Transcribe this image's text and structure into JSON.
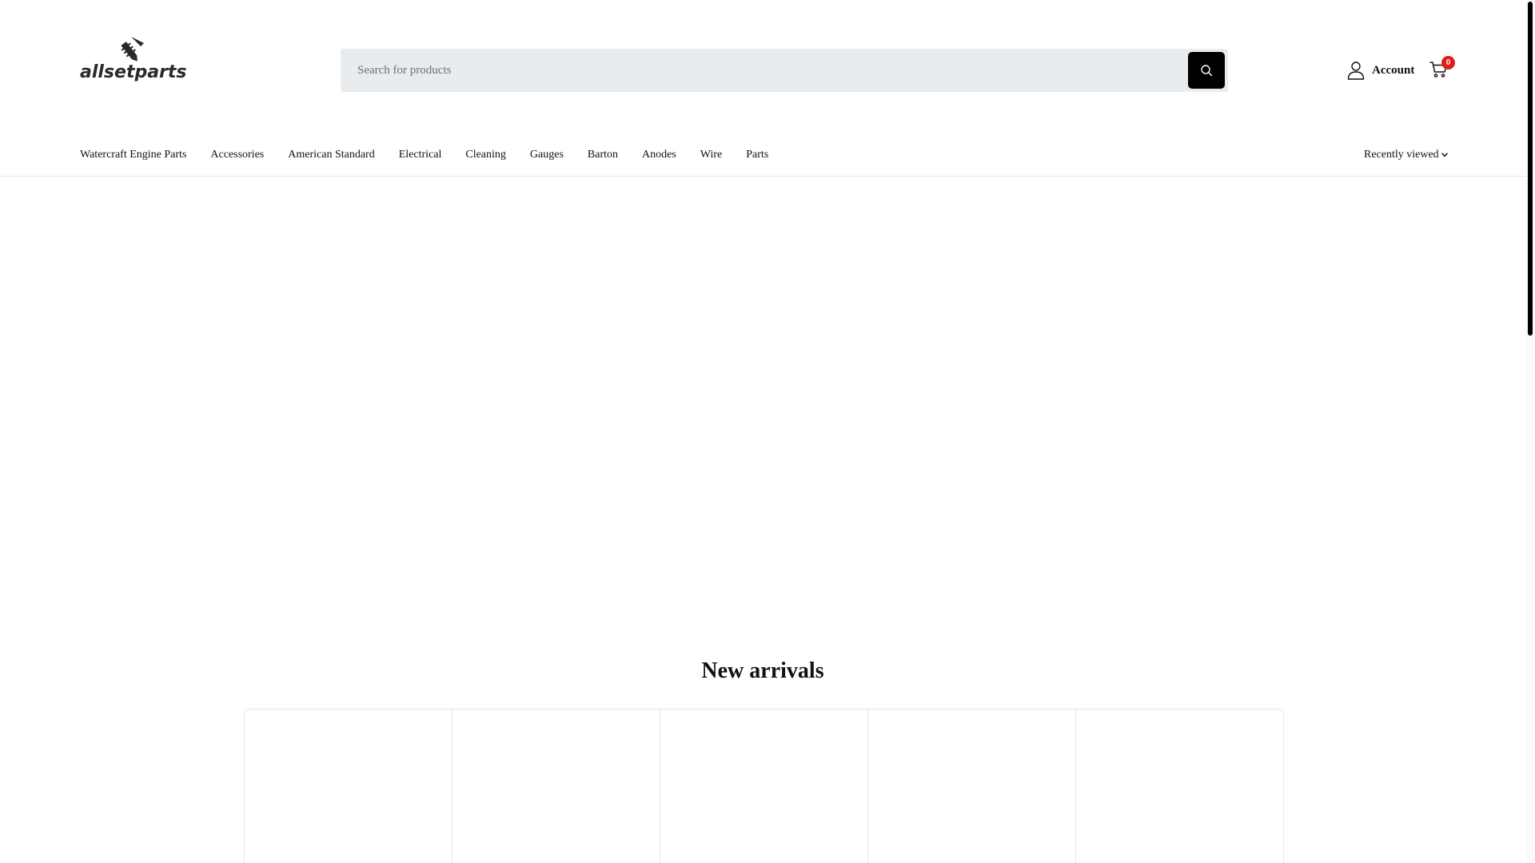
{
  "brand": {
    "logo_text": "allsetparts"
  },
  "search": {
    "placeholder": "Search for products"
  },
  "header": {
    "account_label": "Account",
    "cart_count": "0"
  },
  "nav": {
    "items": [
      "Watercraft Engine Parts",
      "Accessories",
      "American Standard",
      "Electrical",
      "Cleaning",
      "Gauges",
      "Barton",
      "Anodes",
      "Wire",
      "Parts"
    ],
    "recently_viewed": "Recently viewed"
  },
  "section": {
    "title": "New arrivals"
  },
  "colors": {
    "badge": "#e01d1d",
    "search_bg": "#e9ecee",
    "search_button": "#000000"
  },
  "icons": {
    "logo": "screw-logo-icon",
    "search": "search-icon",
    "account": "user-icon",
    "cart": "cart-icon",
    "dropdown": "chevron-down-icon"
  }
}
